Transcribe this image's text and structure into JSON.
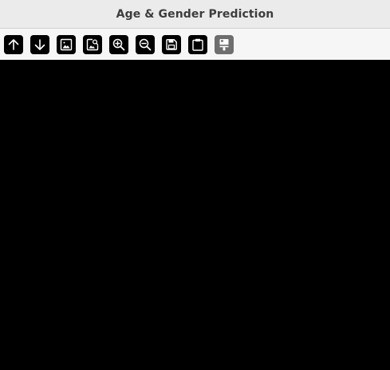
{
  "window": {
    "title": "Age & Gender Prediction"
  },
  "toolbar": {
    "buttons": [
      {
        "icon": "arrow-up-icon",
        "enabled": true
      },
      {
        "icon": "arrow-down-icon",
        "enabled": true
      },
      {
        "icon": "image-icon",
        "enabled": true
      },
      {
        "icon": "image-search-icon",
        "enabled": true
      },
      {
        "icon": "zoom-in-icon",
        "enabled": true
      },
      {
        "icon": "zoom-out-icon",
        "enabled": true
      },
      {
        "icon": "save-icon",
        "enabled": true
      },
      {
        "icon": "clipboard-icon",
        "enabled": true
      },
      {
        "icon": "paint-brush-icon",
        "enabled": false
      }
    ]
  },
  "colors": {
    "titlebar_bg": "#ebebeb",
    "title_text": "#3d3d3d",
    "toolbar_bg": "#f6f6f6",
    "button_bg": "#000000",
    "button_disabled_bg": "#6e6e6e",
    "canvas_bg": "#000000"
  }
}
